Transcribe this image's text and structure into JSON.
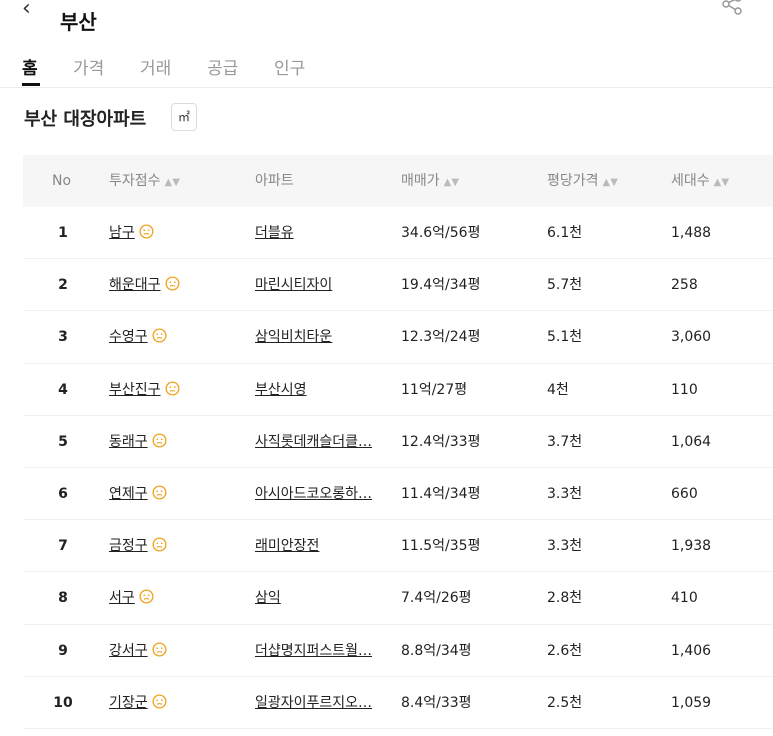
{
  "header": {
    "title": "부산",
    "back_glyph": "‹"
  },
  "icons": {
    "back": "back-chevron-icon",
    "share": "share-icon",
    "face": "neutral-face-icon",
    "sort": "sort-arrows-icon"
  },
  "colors": {
    "face": "#f0a31c",
    "active_tab": "#111111",
    "inactive_tab": "#999999",
    "header_bg": "#f6f6f7"
  },
  "tabs": [
    {
      "label": "홈",
      "active": true
    },
    {
      "label": "가격",
      "active": false
    },
    {
      "label": "거래",
      "active": false
    },
    {
      "label": "공급",
      "active": false
    },
    {
      "label": "인구",
      "active": false
    }
  ],
  "section": {
    "title": "부산 대장아파트",
    "unit": "㎡"
  },
  "table": {
    "columns": [
      "No",
      "투자점수",
      "아파트",
      "매매가",
      "평당가격",
      "세대수"
    ],
    "rows": [
      {
        "no": "1",
        "district": "남구",
        "apartment": "더블유",
        "price": "34.6억/56평",
        "per_pyeong": "6.1천",
        "units": "1,488"
      },
      {
        "no": "2",
        "district": "해운대구",
        "apartment": "마린시티자이",
        "price": "19.4억/34평",
        "per_pyeong": "5.7천",
        "units": "258"
      },
      {
        "no": "3",
        "district": "수영구",
        "apartment": "삼익비치타운",
        "price": "12.3억/24평",
        "per_pyeong": "5.1천",
        "units": "3,060"
      },
      {
        "no": "4",
        "district": "부산진구",
        "apartment": "부산시영",
        "price": "11억/27평",
        "per_pyeong": "4천",
        "units": "110"
      },
      {
        "no": "5",
        "district": "동래구",
        "apartment": "사직롯데캐슬더클…",
        "price": "12.4억/33평",
        "per_pyeong": "3.7천",
        "units": "1,064"
      },
      {
        "no": "6",
        "district": "연제구",
        "apartment": "아시아드코오롱하…",
        "price": "11.4억/34평",
        "per_pyeong": "3.3천",
        "units": "660"
      },
      {
        "no": "7",
        "district": "금정구",
        "apartment": "래미안장전",
        "price": "11.5억/35평",
        "per_pyeong": "3.3천",
        "units": "1,938"
      },
      {
        "no": "8",
        "district": "서구",
        "apartment": "삼익",
        "price": "7.4억/26평",
        "per_pyeong": "2.8천",
        "units": "410"
      },
      {
        "no": "9",
        "district": "강서구",
        "apartment": "더샵명지퍼스트월…",
        "price": "8.8억/34평",
        "per_pyeong": "2.6천",
        "units": "1,406"
      },
      {
        "no": "10",
        "district": "기장군",
        "apartment": "일광자이푸르지오…",
        "price": "8.4억/33평",
        "per_pyeong": "2.5천",
        "units": "1,059"
      }
    ]
  }
}
